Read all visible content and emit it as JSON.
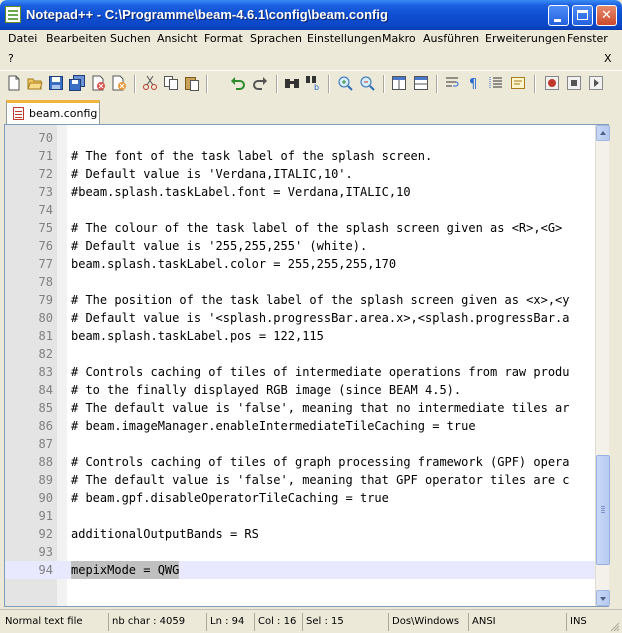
{
  "window": {
    "title": "Notepad++ - C:\\Programme\\beam-4.6.1\\config\\beam.config"
  },
  "menu": {
    "items": [
      "Datei",
      "Bearbeiten",
      "Suchen",
      "Ansicht",
      "Format",
      "Sprachen",
      "Einstellungen",
      "Makro",
      "Ausführen",
      "Erweiterungen",
      "Fenster"
    ],
    "second_row": [
      "?"
    ],
    "close_doc": "X"
  },
  "toolbar": {
    "icons": [
      "new-file-icon",
      "open-file-icon",
      "save-icon",
      "save-all-icon",
      "close-icon",
      "close-all-icon",
      "cut-icon",
      "copy-icon",
      "paste-icon",
      "undo-icon",
      "redo-icon",
      "find-icon",
      "replace-icon",
      "zoom-in-icon",
      "zoom-out-icon",
      "sync-vertical-icon",
      "sync-horizontal-icon",
      "word-wrap-icon",
      "show-all-chars-icon",
      "indent-guide-icon",
      "user-lang-icon",
      "macro-record-icon",
      "macro-stop-icon",
      "macro-play-icon"
    ]
  },
  "tabs": [
    {
      "label": "beam.config",
      "active": true
    }
  ],
  "editor": {
    "lines": [
      {
        "num": "70",
        "text": ""
      },
      {
        "num": "71",
        "text": "# The font of the task label of the splash screen."
      },
      {
        "num": "72",
        "text": "# Default value is 'Verdana,ITALIC,10'."
      },
      {
        "num": "73",
        "text": "#beam.splash.taskLabel.font = Verdana,ITALIC,10"
      },
      {
        "num": "74",
        "text": ""
      },
      {
        "num": "75",
        "text": "# The colour of the task label of the splash screen given as <R>,<G>"
      },
      {
        "num": "76",
        "text": "# Default value is '255,255,255' (white)."
      },
      {
        "num": "77",
        "text": "beam.splash.taskLabel.color = 255,255,255,170"
      },
      {
        "num": "78",
        "text": ""
      },
      {
        "num": "79",
        "text": "# The position of the task label of the splash screen given as <x>,<y"
      },
      {
        "num": "80",
        "text": "# Default value is '<splash.progressBar.area.x>,<splash.progressBar.a"
      },
      {
        "num": "81",
        "text": "beam.splash.taskLabel.pos = 122,115"
      },
      {
        "num": "82",
        "text": ""
      },
      {
        "num": "83",
        "text": "# Controls caching of tiles of intermediate operations from raw produ"
      },
      {
        "num": "84",
        "text": "# to the finally displayed RGB image (since BEAM 4.5)."
      },
      {
        "num": "85",
        "text": "# The default value is 'false', meaning that no intermediate tiles ar"
      },
      {
        "num": "86",
        "text": "# beam.imageManager.enableIntermediateTileCaching = true"
      },
      {
        "num": "87",
        "text": ""
      },
      {
        "num": "88",
        "text": "# Controls caching of tiles of graph processing framework (GPF) opera"
      },
      {
        "num": "89",
        "text": "# The default value is 'false', meaning that GPF operator tiles are c"
      },
      {
        "num": "90",
        "text": "# beam.gpf.disableOperatorTileCaching = true"
      },
      {
        "num": "91",
        "text": ""
      },
      {
        "num": "92",
        "text": "additionalOutputBands = RS"
      },
      {
        "num": "93",
        "text": ""
      },
      {
        "num": "94",
        "text": "mepixMode = QWG"
      }
    ],
    "current_line": "94"
  },
  "status": {
    "type": "Normal text file",
    "chars": "nb char : 4059",
    "ln": "Ln : 94",
    "col": "Col : 16",
    "sel": "Sel : 15",
    "eol": "Dos\\Windows",
    "encoding": "ANSI",
    "mode": "INS"
  },
  "colors": {
    "title_bar": "#0f4fd3",
    "tab_accent": "#f0b43c",
    "current_line": "#e8e8ff",
    "selection": "#c0c0c0"
  }
}
